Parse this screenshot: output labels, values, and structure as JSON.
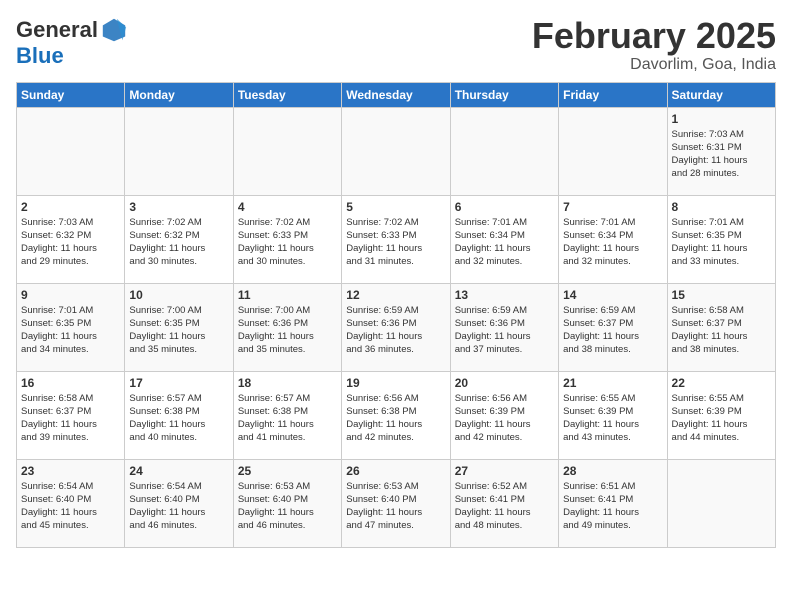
{
  "header": {
    "logo_general": "General",
    "logo_blue": "Blue",
    "month_title": "February 2025",
    "location": "Davorlim, Goa, India"
  },
  "days_of_week": [
    "Sunday",
    "Monday",
    "Tuesday",
    "Wednesday",
    "Thursday",
    "Friday",
    "Saturday"
  ],
  "weeks": [
    [
      {
        "num": "",
        "info": ""
      },
      {
        "num": "",
        "info": ""
      },
      {
        "num": "",
        "info": ""
      },
      {
        "num": "",
        "info": ""
      },
      {
        "num": "",
        "info": ""
      },
      {
        "num": "",
        "info": ""
      },
      {
        "num": "1",
        "info": "Sunrise: 7:03 AM\nSunset: 6:31 PM\nDaylight: 11 hours\nand 28 minutes."
      }
    ],
    [
      {
        "num": "2",
        "info": "Sunrise: 7:03 AM\nSunset: 6:32 PM\nDaylight: 11 hours\nand 29 minutes."
      },
      {
        "num": "3",
        "info": "Sunrise: 7:02 AM\nSunset: 6:32 PM\nDaylight: 11 hours\nand 30 minutes."
      },
      {
        "num": "4",
        "info": "Sunrise: 7:02 AM\nSunset: 6:33 PM\nDaylight: 11 hours\nand 30 minutes."
      },
      {
        "num": "5",
        "info": "Sunrise: 7:02 AM\nSunset: 6:33 PM\nDaylight: 11 hours\nand 31 minutes."
      },
      {
        "num": "6",
        "info": "Sunrise: 7:01 AM\nSunset: 6:34 PM\nDaylight: 11 hours\nand 32 minutes."
      },
      {
        "num": "7",
        "info": "Sunrise: 7:01 AM\nSunset: 6:34 PM\nDaylight: 11 hours\nand 32 minutes."
      },
      {
        "num": "8",
        "info": "Sunrise: 7:01 AM\nSunset: 6:35 PM\nDaylight: 11 hours\nand 33 minutes."
      }
    ],
    [
      {
        "num": "9",
        "info": "Sunrise: 7:01 AM\nSunset: 6:35 PM\nDaylight: 11 hours\nand 34 minutes."
      },
      {
        "num": "10",
        "info": "Sunrise: 7:00 AM\nSunset: 6:35 PM\nDaylight: 11 hours\nand 35 minutes."
      },
      {
        "num": "11",
        "info": "Sunrise: 7:00 AM\nSunset: 6:36 PM\nDaylight: 11 hours\nand 35 minutes."
      },
      {
        "num": "12",
        "info": "Sunrise: 6:59 AM\nSunset: 6:36 PM\nDaylight: 11 hours\nand 36 minutes."
      },
      {
        "num": "13",
        "info": "Sunrise: 6:59 AM\nSunset: 6:36 PM\nDaylight: 11 hours\nand 37 minutes."
      },
      {
        "num": "14",
        "info": "Sunrise: 6:59 AM\nSunset: 6:37 PM\nDaylight: 11 hours\nand 38 minutes."
      },
      {
        "num": "15",
        "info": "Sunrise: 6:58 AM\nSunset: 6:37 PM\nDaylight: 11 hours\nand 38 minutes."
      }
    ],
    [
      {
        "num": "16",
        "info": "Sunrise: 6:58 AM\nSunset: 6:37 PM\nDaylight: 11 hours\nand 39 minutes."
      },
      {
        "num": "17",
        "info": "Sunrise: 6:57 AM\nSunset: 6:38 PM\nDaylight: 11 hours\nand 40 minutes."
      },
      {
        "num": "18",
        "info": "Sunrise: 6:57 AM\nSunset: 6:38 PM\nDaylight: 11 hours\nand 41 minutes."
      },
      {
        "num": "19",
        "info": "Sunrise: 6:56 AM\nSunset: 6:38 PM\nDaylight: 11 hours\nand 42 minutes."
      },
      {
        "num": "20",
        "info": "Sunrise: 6:56 AM\nSunset: 6:39 PM\nDaylight: 11 hours\nand 42 minutes."
      },
      {
        "num": "21",
        "info": "Sunrise: 6:55 AM\nSunset: 6:39 PM\nDaylight: 11 hours\nand 43 minutes."
      },
      {
        "num": "22",
        "info": "Sunrise: 6:55 AM\nSunset: 6:39 PM\nDaylight: 11 hours\nand 44 minutes."
      }
    ],
    [
      {
        "num": "23",
        "info": "Sunrise: 6:54 AM\nSunset: 6:40 PM\nDaylight: 11 hours\nand 45 minutes."
      },
      {
        "num": "24",
        "info": "Sunrise: 6:54 AM\nSunset: 6:40 PM\nDaylight: 11 hours\nand 46 minutes."
      },
      {
        "num": "25",
        "info": "Sunrise: 6:53 AM\nSunset: 6:40 PM\nDaylight: 11 hours\nand 46 minutes."
      },
      {
        "num": "26",
        "info": "Sunrise: 6:53 AM\nSunset: 6:40 PM\nDaylight: 11 hours\nand 47 minutes."
      },
      {
        "num": "27",
        "info": "Sunrise: 6:52 AM\nSunset: 6:41 PM\nDaylight: 11 hours\nand 48 minutes."
      },
      {
        "num": "28",
        "info": "Sunrise: 6:51 AM\nSunset: 6:41 PM\nDaylight: 11 hours\nand 49 minutes."
      },
      {
        "num": "",
        "info": ""
      }
    ]
  ]
}
